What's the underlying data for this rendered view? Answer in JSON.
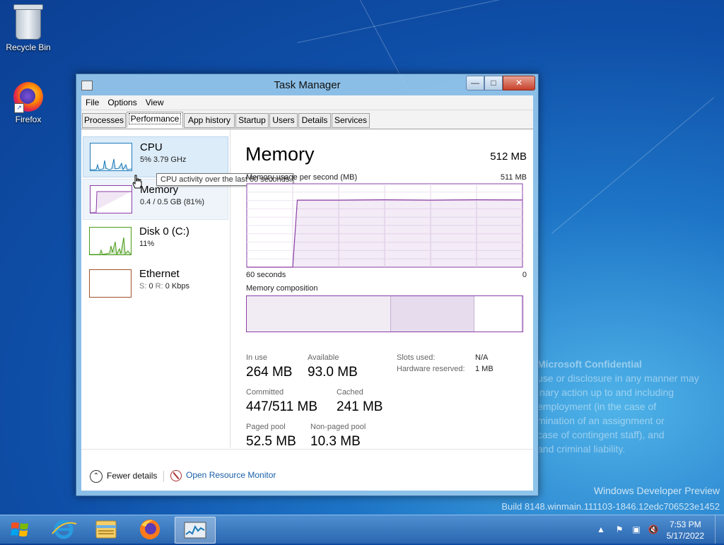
{
  "desktop": {
    "icons": [
      {
        "label": "Recycle Bin",
        "icon": "recycle-bin-icon"
      },
      {
        "label": "Firefox",
        "icon": "firefox-icon"
      }
    ],
    "watermark": {
      "title": "Microsoft Confidential",
      "lines": [
        "use or disclosure in any manner may",
        "inary action up to and including",
        "employment (in the case of",
        "mination of an assignment or",
        "case of contingent staff), and",
        "and criminal liability."
      ]
    },
    "build": {
      "line1": "Windows Developer Preview",
      "line2": "Build 8148.winmain.111103-1846.12edc706523e1452"
    }
  },
  "window": {
    "title": "Task Manager",
    "controls": {
      "minimize": "—",
      "maximize": "□",
      "close": "✕"
    },
    "menu": [
      "File",
      "Options",
      "View"
    ],
    "tabs": [
      "Processes",
      "Performance",
      "App history",
      "Startup",
      "Users",
      "Details",
      "Services"
    ],
    "active_tab": "Performance",
    "resources": [
      {
        "name": "CPU",
        "detail": "5%  3.79 GHz",
        "color": "#1a7ab8"
      },
      {
        "name": "Memory",
        "detail": "0.4 / 0.5 GB (81%)",
        "color": "#8b3da6"
      },
      {
        "name": "Disk 0 (C:)",
        "detail": "11%",
        "color": "#4a9b1a"
      },
      {
        "name": "Ethernet",
        "detail_s_label": "S:",
        "detail_s": "0",
        "detail_r_label": "R:",
        "detail_r": "0 Kbps",
        "color": "#a0522d"
      }
    ],
    "tooltip": "CPU activity over the last 60 seconds",
    "memory": {
      "title": "Memory",
      "total": "512 MB",
      "usage_label": "Memory usage per second (MB)",
      "usage_max": "511 MB",
      "axis_left": "60 seconds",
      "axis_right": "0",
      "composition_label": "Memory composition",
      "stats": {
        "in_use_label": "In use",
        "in_use": "264 MB",
        "available_label": "Available",
        "available": "93.0 MB",
        "committed_label": "Committed",
        "committed": "447/511 MB",
        "cached_label": "Cached",
        "cached": "241 MB",
        "paged_label": "Paged pool",
        "paged": "52.5 MB",
        "nonpaged_label": "Non-paged pool",
        "nonpaged": "10.3 MB",
        "slots_label": "Slots used:",
        "slots": "N/A",
        "hwres_label": "Hardware reserved:",
        "hwres": "1 MB"
      }
    },
    "footer": {
      "fewer_details": "Fewer details",
      "open_resource_monitor": "Open Resource Monitor"
    }
  },
  "taskbar": {
    "items": [
      "internet-explorer-icon",
      "file-explorer-icon",
      "firefox-icon",
      "task-manager-icon"
    ],
    "clock_time": "7:53 PM",
    "clock_date": "5/17/2022"
  },
  "chart_data": [
    {
      "type": "line",
      "title": "Memory usage per second (MB)",
      "xlabel": "",
      "ylabel": "",
      "x_range_label": [
        "60 seconds",
        "0"
      ],
      "ylim": [
        0,
        511
      ],
      "x": [
        60,
        50,
        49,
        40,
        30,
        20,
        10,
        0
      ],
      "series": [
        {
          "values": [
            0,
            0,
            411,
            411,
            413,
            411,
            413,
            412
          ]
        }
      ]
    }
  ]
}
